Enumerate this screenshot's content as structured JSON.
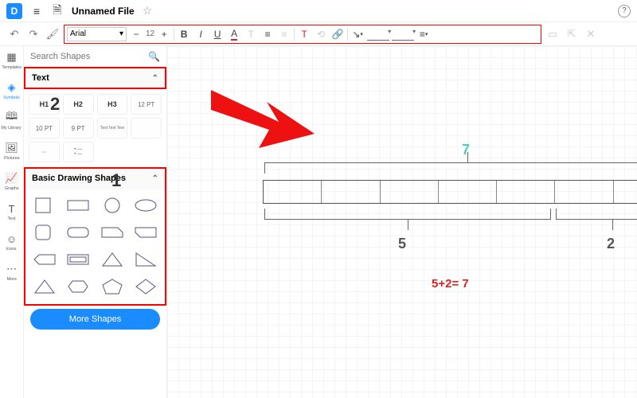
{
  "header": {
    "filename": "Unnamed File"
  },
  "toolbar": {
    "font": "Arial",
    "fontsize": "12"
  },
  "nav": {
    "templates": "Templates",
    "symbols": "Symbols",
    "mylibrary": "My Library",
    "pictures": "Pictures",
    "graphs": "Graphs",
    "text": "Text",
    "icons": "Icons",
    "more": "More"
  },
  "search": {
    "placeholder": "Search Shapes"
  },
  "sections": {
    "text": "Text",
    "shapes": "Basic Drawing Shapes"
  },
  "textItems": {
    "h1": "H1",
    "h2": "H2",
    "h3": "H3",
    "p12": "12 PT",
    "p10": "10 PT",
    "p9": "9 PT",
    "tlines": "Text Text Text"
  },
  "moreShapes": "More Shapes",
  "annotations": {
    "step1": "1",
    "step2": "2"
  },
  "diagram": {
    "top": "7",
    "left": "5",
    "right": "2",
    "equation": "5+2= 7"
  }
}
